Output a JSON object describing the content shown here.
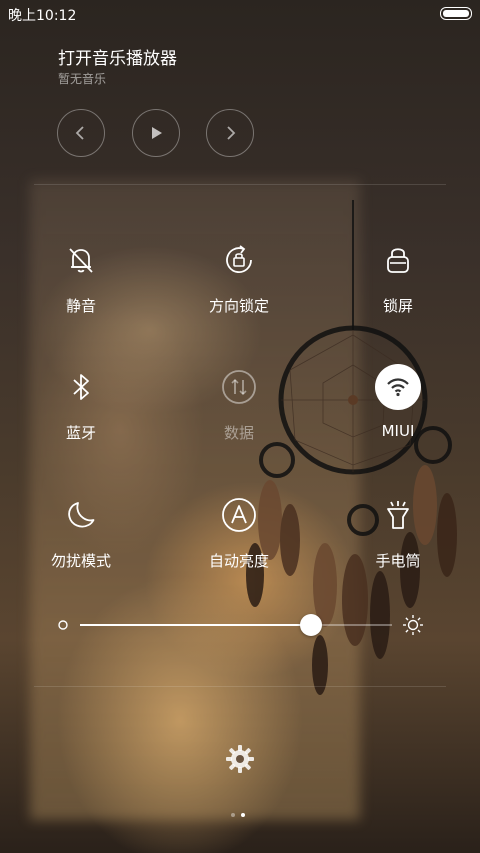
{
  "status_bar": {
    "time": "晚上10:12",
    "battery_level": 1.0
  },
  "music": {
    "title": "打开音乐播放器",
    "subtitle": "暂无音乐",
    "controls": [
      {
        "id": "prev",
        "icon": "chevron-left-icon"
      },
      {
        "id": "play",
        "icon": "play-icon"
      },
      {
        "id": "next",
        "icon": "chevron-right-icon"
      }
    ]
  },
  "toggles": [
    {
      "id": "mute",
      "label": "静音",
      "icon": "bell-off-icon",
      "active": false,
      "dim": false
    },
    {
      "id": "rotation_lock",
      "label": "方向锁定",
      "icon": "rotation-lock-icon",
      "active": false,
      "dim": false
    },
    {
      "id": "lock_screen",
      "label": "锁屏",
      "icon": "lock-icon",
      "active": false,
      "dim": false
    },
    {
      "id": "bluetooth",
      "label": "蓝牙",
      "icon": "bluetooth-icon",
      "active": false,
      "dim": false
    },
    {
      "id": "data",
      "label": "数据",
      "icon": "mobile-data-icon",
      "active": false,
      "dim": true
    },
    {
      "id": "wifi",
      "label": "MIUI",
      "icon": "wifi-icon",
      "active": true,
      "dim": false
    },
    {
      "id": "dnd",
      "label": "勿扰模式",
      "icon": "moon-icon",
      "active": false,
      "dim": false
    },
    {
      "id": "auto_brightness",
      "label": "自动亮度",
      "icon": "auto-brightness-icon",
      "active": false,
      "dim": false
    },
    {
      "id": "flashlight",
      "label": "手电筒",
      "icon": "flashlight-icon",
      "active": false,
      "dim": false
    }
  ],
  "brightness": {
    "level": 0.74,
    "min_icon": "brightness-low-icon",
    "max_icon": "brightness-high-icon"
  },
  "settings_icon": "gear-icon",
  "pager": {
    "count": 2,
    "current": 1
  },
  "colors": {
    "accent": "#ffffff",
    "wifi_active_bg": "#ffffff",
    "wifi_active_fg": "#333333"
  }
}
